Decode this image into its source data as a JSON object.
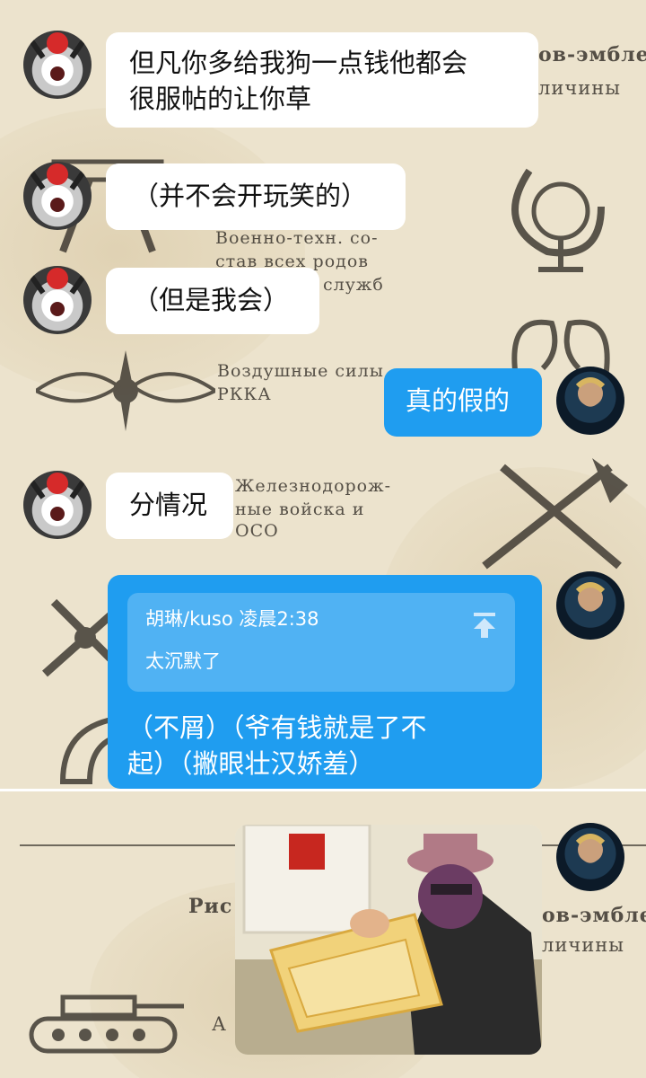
{
  "background": {
    "texts": [
      "ов-эмбле",
      "личины",
      "Военно-техн. со-",
      "став всех родов",
      "служб",
      "Воздушные силы",
      "РККА",
      "Железнодорож-",
      "ные войска и",
      "ОСО",
      "Рис",
      "ов-эмбле",
      "личины",
      "А"
    ]
  },
  "messages": [
    {
      "text": "但凡你多给我狗一点钱他都会很服帖的让你草",
      "line1": "但凡你多给我狗一点钱他都会",
      "line2": "很服帖的让你草"
    },
    {
      "text": "（并不会开玩笑的）"
    },
    {
      "text": "（但是我会）"
    },
    {
      "text": "真的假的"
    },
    {
      "text": "分情况"
    },
    {
      "quote_author": "胡琳/kuso 凌晨2:38",
      "quote_text": "太沉默了",
      "line1": "（不屑）（爷有钱就是了不",
      "line2": "起）（撇眼壮汉娇羞）"
    }
  ],
  "colors": {
    "bubble_left": "#ffffff",
    "bubble_right": "#1f9df0",
    "paper_bg": "#ece3cd"
  }
}
